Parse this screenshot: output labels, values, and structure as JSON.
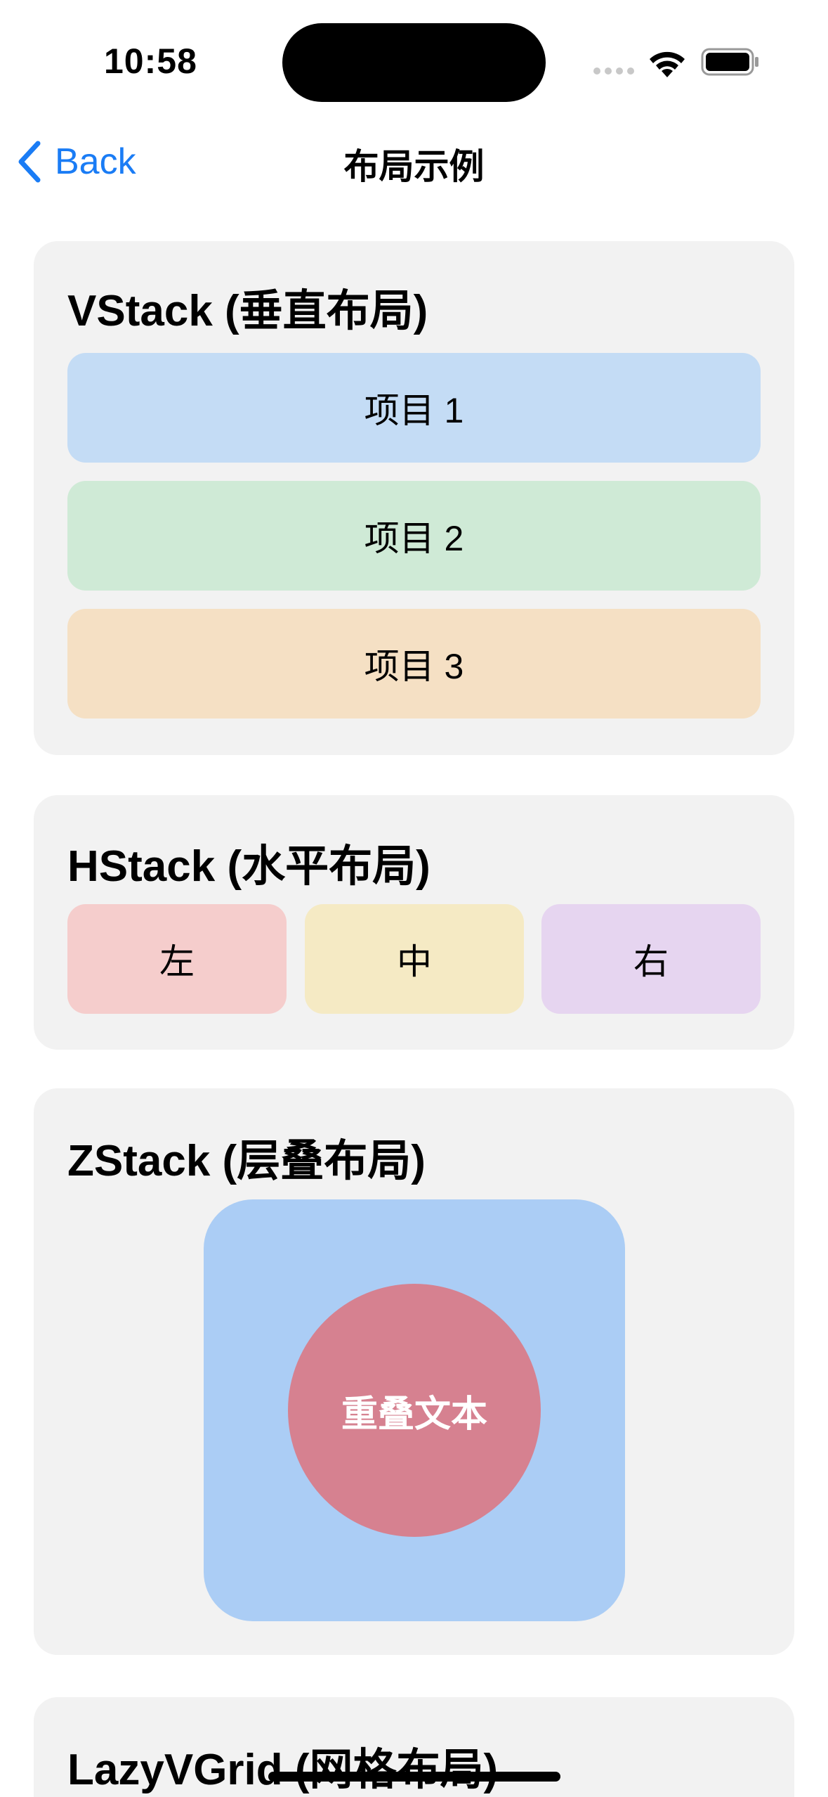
{
  "status": {
    "time": "10:58"
  },
  "nav": {
    "back_label": "Back",
    "title": "布局示例"
  },
  "vstack": {
    "title": "VStack (垂直布局)",
    "items": [
      {
        "label": "项目 1",
        "color": "#c4dcf5"
      },
      {
        "label": "项目 2",
        "color": "#cfead6"
      },
      {
        "label": "项目 3",
        "color": "#f5e0c4"
      }
    ]
  },
  "hstack": {
    "title": "HStack (水平布局)",
    "items": [
      {
        "label": "左",
        "color": "#f5cdcc"
      },
      {
        "label": "中",
        "color": "#f5eac4"
      },
      {
        "label": "右",
        "color": "#e6d5f0"
      }
    ]
  },
  "zstack": {
    "title": "ZStack (层叠布局)",
    "overlay_text": "重叠文本",
    "square_color": "#abcdf5",
    "circle_color": "#d68190"
  },
  "lazyvgrid": {
    "title": "LazyVGrid (网格布局)"
  },
  "colors": {
    "accent": "#1a7cf5",
    "card_background": "#f2f2f2"
  }
}
